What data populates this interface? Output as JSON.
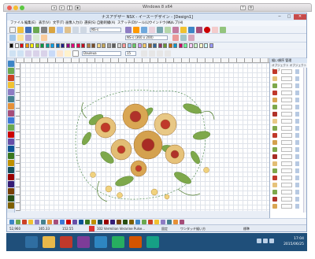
{
  "host_window": {
    "title": "Windows 8 x64"
  },
  "app": {
    "title": "ナスアデザー NSX - イースーデザイン - [Design1]",
    "window_buttons": [
      "─",
      "□",
      "✕"
    ]
  },
  "menu": [
    "ファイル",
    "編集(E)",
    "表示(V)",
    "文字(T)",
    "画像入力(I)",
    "選択(S)",
    "自動刺繍(A)",
    "ステッチ(D)",
    "ツール(L)",
    "ウインドウ(W)",
    "ヘルプ(H)"
  ],
  "toolbar": {
    "design_field": "NS-s",
    "hoop_field": "NS-s (360 x 200)"
  },
  "lettering_bar": {
    "font": "Dauleua",
    "size": "15"
  },
  "side_panel": {
    "header": "縫い順序 管理",
    "tab": "オブジェクト オブジェクトタイプ"
  },
  "status": {
    "left": "52,960",
    "count": "165.33",
    "zoom": "152.55",
    "thread": "102 Vermilion Verarine Pulse...",
    "mode": "固定",
    "hint": "ワンタッチ縫い方",
    "tag": "標準"
  },
  "taskbar": {
    "time": "17:04",
    "date": "2015/06/25"
  },
  "colors": {
    "palette": [
      "#000000",
      "#ffffff",
      "#e60012",
      "#f39800",
      "#fff100",
      "#8fc31f",
      "#009944",
      "#009e96",
      "#00a0e9",
      "#0068b7",
      "#1d2088",
      "#920783",
      "#e4007f",
      "#e5004f",
      "#c30d23",
      "#b28146",
      "#7c4e2a",
      "#f5d98c",
      "#c8a85c",
      "#a0a0a0",
      "#606060",
      "#d8d8d8",
      "#ff9999",
      "#99ccff",
      "#66cc66",
      "#cc99ff",
      "#ffcc66",
      "#996633",
      "#336699",
      "#993366",
      "#669933",
      "#cc6600",
      "#0099cc",
      "#cc0066",
      "#66ff99",
      "#ffccff",
      "#ccffcc",
      "#ffffcc",
      "#ccffff",
      "#9999ff"
    ]
  }
}
